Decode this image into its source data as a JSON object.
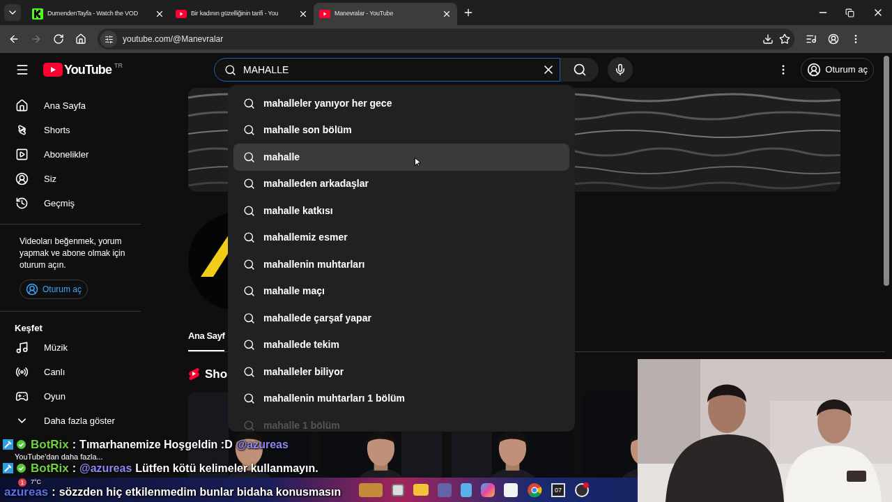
{
  "browser": {
    "tabs": [
      {
        "title": "DumendenTayfa - Watch the VOD",
        "kind": "kick",
        "selected": false
      },
      {
        "title": "Bir kadının güzelliğinin tarifi - You",
        "kind": "youtube",
        "selected": false
      },
      {
        "title": "Manevralar - YouTube",
        "kind": "youtube",
        "selected": true
      }
    ],
    "url": "youtube.com/@Manevralar"
  },
  "header": {
    "logo_text": "YouTube",
    "region": "TR",
    "search": {
      "value": "MAHALLE"
    },
    "sign_in": "Oturum aç"
  },
  "sidebar": {
    "items": [
      {
        "label": "Ana Sayfa"
      },
      {
        "label": "Shorts"
      },
      {
        "label": "Abonelikler"
      },
      {
        "label": "Siz"
      },
      {
        "label": "Geçmiş"
      }
    ],
    "prompt": "Videoları beğenmek, yorum yapmak ve abone olmak için oturum açın.",
    "sign_in": "Oturum aç",
    "explore_title": "Keşfet",
    "explore": [
      {
        "label": "Müzik"
      },
      {
        "label": "Canlı"
      },
      {
        "label": "Oyun"
      },
      {
        "label": "Daha fazla göster"
      }
    ],
    "more": "YouTube'dan daha fazla..."
  },
  "channel": {
    "tabs": [
      {
        "label": "Ana Sayf",
        "selected": true
      }
    ],
    "shelf_title": "Sho"
  },
  "suggestions": [
    {
      "text": "mahalleler yanıyor her gece",
      "selected": false,
      "faded": false
    },
    {
      "text": "mahalle son bölüm",
      "selected": false,
      "faded": false
    },
    {
      "text": "mahalle",
      "selected": true,
      "faded": false
    },
    {
      "text": "mahalleden arkadaşlar",
      "selected": false,
      "faded": false
    },
    {
      "text": "mahalle katkısı",
      "selected": false,
      "faded": false
    },
    {
      "text": "mahallemiz esmer",
      "selected": false,
      "faded": false
    },
    {
      "text": "mahallenin muhtarları",
      "selected": false,
      "faded": false
    },
    {
      "text": "mahalle maçı",
      "selected": false,
      "faded": false
    },
    {
      "text": "mahallede çarşaf yapar",
      "selected": false,
      "faded": false
    },
    {
      "text": "mahallede tekim",
      "selected": false,
      "faded": false
    },
    {
      "text": "mahalleler biliyor",
      "selected": false,
      "faded": false
    },
    {
      "text": "mahallenin muhtarları 1 bölüm",
      "selected": false,
      "faded": false
    },
    {
      "text": "mahalle 1 bölüm",
      "selected": false,
      "faded": true
    }
  ],
  "chat": [
    {
      "user": "BotRix",
      "color": "#6fd23f",
      "badges": true,
      "separator": ":",
      "segments": [
        {
          "kind": "text",
          "text": "Tımarhanemize Hoşgeldin :D"
        },
        {
          "kind": "mention",
          "text": "@azureas"
        }
      ]
    },
    {
      "user": "BotRix",
      "color": "#6fd23f",
      "badges": true,
      "separator": ":",
      "segments": [
        {
          "kind": "mention",
          "text": "@azureas"
        },
        {
          "kind": "text",
          "text": "Lütfen kötü kelimeler kullanmayın."
        }
      ]
    },
    {
      "user": "azureas",
      "color": "#5b73f2",
      "badges": false,
      "separator": ":",
      "segments": [
        {
          "kind": "text",
          "text": "sözzden hiç etkilenmedim bunlar bidaha konusmasın"
        }
      ]
    }
  ],
  "taskbar": {
    "weather": "7°C",
    "notifications": "1",
    "date": "07"
  }
}
